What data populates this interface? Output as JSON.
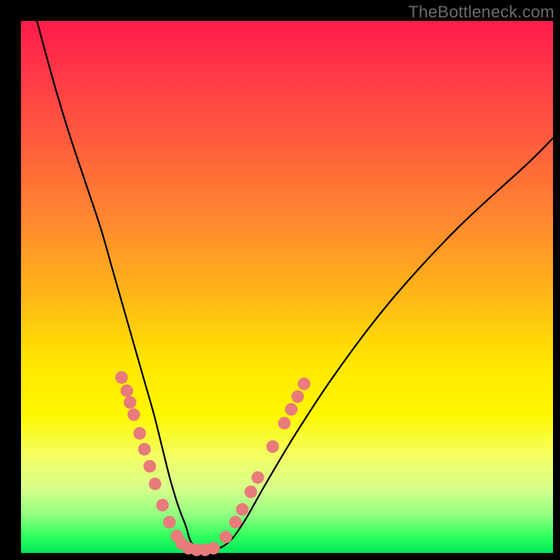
{
  "watermark": "TheBottleneck.com",
  "chart_data": {
    "type": "line",
    "title": "",
    "xlabel": "",
    "ylabel": "",
    "xlim": [
      0,
      100
    ],
    "ylim": [
      0,
      100
    ],
    "grid": false,
    "legend": false,
    "series": [
      {
        "name": "bottleneck-curve",
        "color": "#000000",
        "x": [
          3,
          6,
          9,
          12,
          15,
          17,
          19,
          21,
          23,
          25,
          26.5,
          28,
          29.5,
          31,
          32,
          34,
          36,
          39,
          42,
          46,
          52,
          60,
          70,
          82,
          95,
          100
        ],
        "y": [
          100,
          89,
          79,
          70,
          61,
          54,
          47,
          40,
          33,
          26,
          20,
          14,
          9,
          5,
          2,
          0.5,
          0.5,
          2,
          6,
          13,
          23,
          35,
          48,
          61,
          73,
          78
        ]
      }
    ],
    "scatter_points": {
      "name": "highlighted-points",
      "color": "#e87b7b",
      "radius": 9,
      "points": [
        {
          "x": 18.9,
          "y": 33.0
        },
        {
          "x": 19.9,
          "y": 30.5
        },
        {
          "x": 20.5,
          "y": 28.3
        },
        {
          "x": 21.2,
          "y": 26.0
        },
        {
          "x": 22.3,
          "y": 22.5
        },
        {
          "x": 23.2,
          "y": 19.5
        },
        {
          "x": 24.2,
          "y": 16.3
        },
        {
          "x": 25.2,
          "y": 13.0
        },
        {
          "x": 26.6,
          "y": 9.0
        },
        {
          "x": 27.9,
          "y": 5.8
        },
        {
          "x": 29.3,
          "y": 3.2
        },
        {
          "x": 30.2,
          "y": 1.8
        },
        {
          "x": 31.5,
          "y": 0.9
        },
        {
          "x": 33.0,
          "y": 0.6
        },
        {
          "x": 34.6,
          "y": 0.6
        },
        {
          "x": 36.2,
          "y": 0.9
        },
        {
          "x": 38.5,
          "y": 3.0
        },
        {
          "x": 40.3,
          "y": 5.8
        },
        {
          "x": 41.6,
          "y": 8.2
        },
        {
          "x": 43.2,
          "y": 11.5
        },
        {
          "x": 44.5,
          "y": 14.2
        },
        {
          "x": 47.3,
          "y": 20.0
        },
        {
          "x": 49.5,
          "y": 24.4
        },
        {
          "x": 50.8,
          "y": 27.0
        },
        {
          "x": 52.0,
          "y": 29.4
        },
        {
          "x": 53.2,
          "y": 31.8
        }
      ]
    }
  }
}
